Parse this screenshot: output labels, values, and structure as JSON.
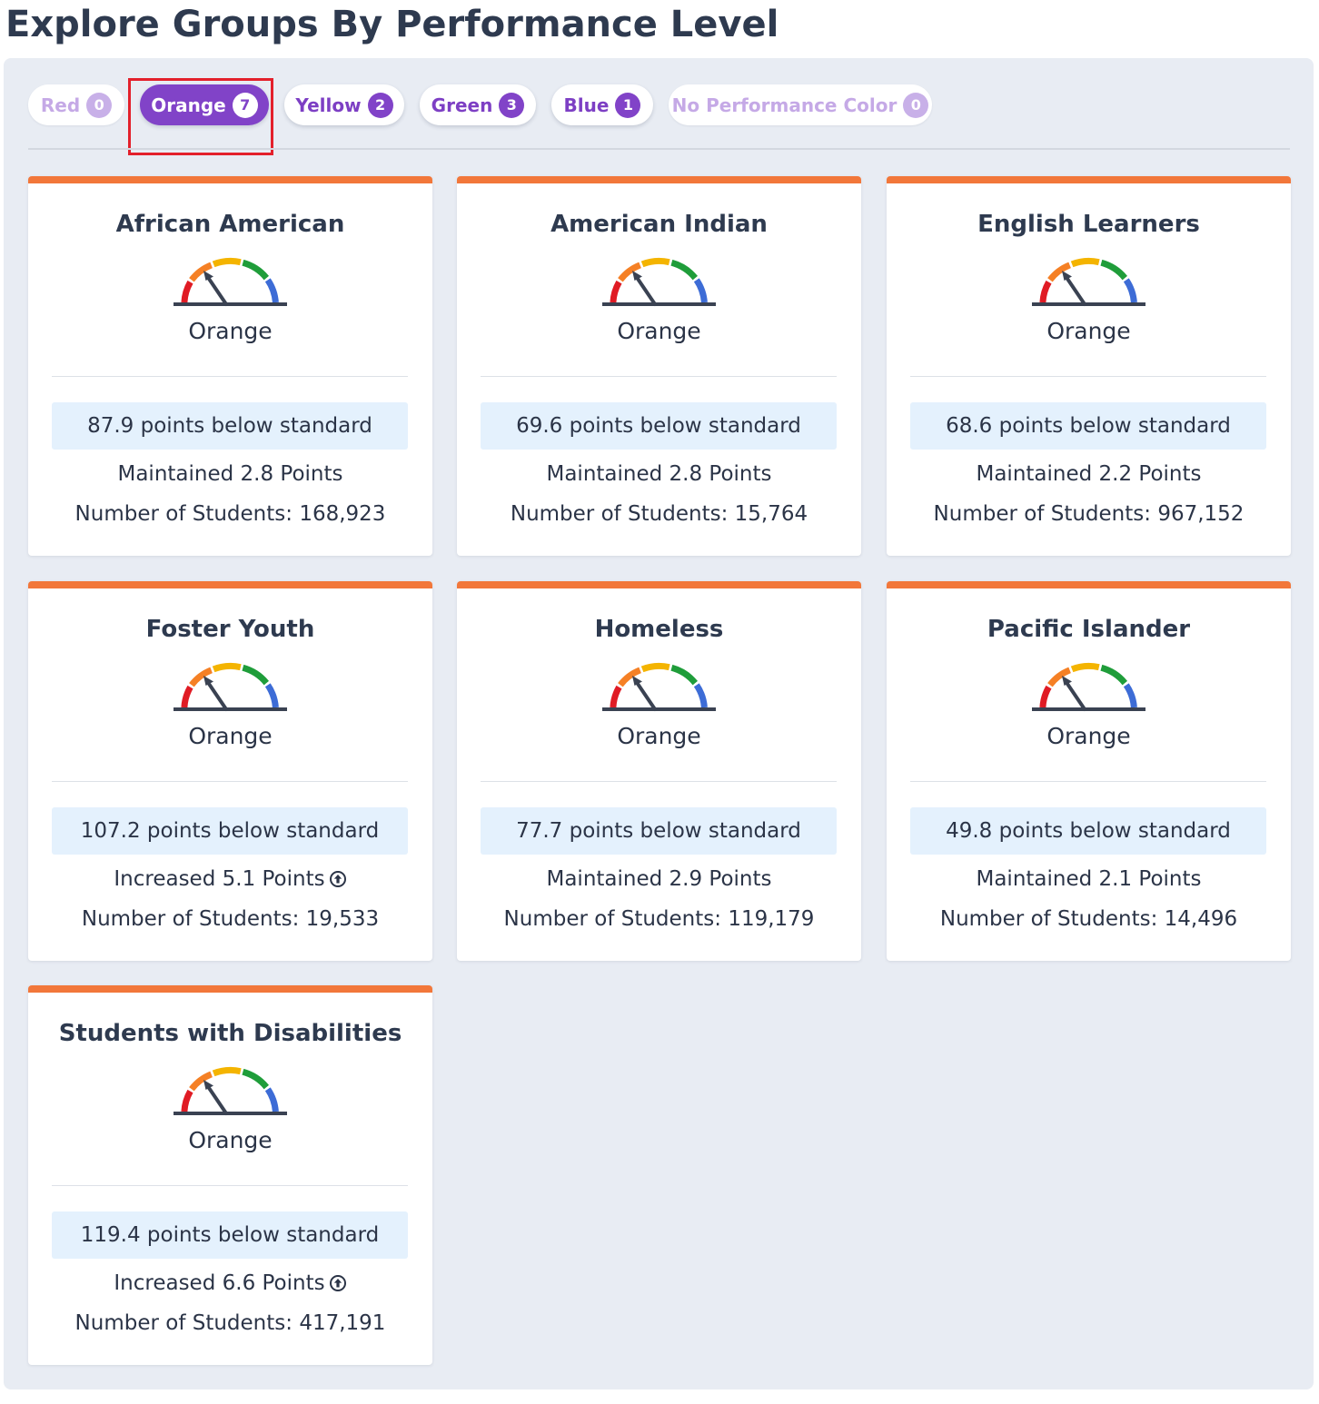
{
  "page": {
    "title": "Explore Groups By Performance Level"
  },
  "filters": [
    {
      "label": "Red",
      "count": "0",
      "state": "disabled"
    },
    {
      "label": "Orange",
      "count": "7",
      "state": "active"
    },
    {
      "label": "Yellow",
      "count": "2",
      "state": "normal"
    },
    {
      "label": "Green",
      "count": "3",
      "state": "normal"
    },
    {
      "label": "Blue",
      "count": "1",
      "state": "normal"
    },
    {
      "label": "No Performance Color",
      "count": "0",
      "state": "disabled"
    }
  ],
  "colors": {
    "accent_purple": "#8143c8",
    "card_top_orange": "#f2773a",
    "gauge_red": "#e01b24",
    "gauge_orange": "#f58025",
    "gauge_yellow": "#f4b400",
    "gauge_green": "#1f9d3a",
    "gauge_blue": "#3d6cd6",
    "highlight_red": "#e3202b"
  },
  "groups": [
    {
      "name": "African American",
      "level": "Orange",
      "status": "87.9 points below standard",
      "change": "Maintained 2.8 Points",
      "change_icon": "",
      "students": "Number of Students: 168,923"
    },
    {
      "name": "American Indian",
      "level": "Orange",
      "status": "69.6 points below standard",
      "change": "Maintained 2.8 Points",
      "change_icon": "",
      "students": "Number of Students: 15,764"
    },
    {
      "name": "English Learners",
      "level": "Orange",
      "status": "68.6 points below standard",
      "change": "Maintained 2.2 Points",
      "change_icon": "",
      "students": "Number of Students: 967,152"
    },
    {
      "name": "Foster Youth",
      "level": "Orange",
      "status": "107.2 points below standard",
      "change": "Increased 5.1 Points",
      "change_icon": "arrow-up-circle-icon",
      "students": "Number of Students: 19,533"
    },
    {
      "name": "Homeless",
      "level": "Orange",
      "status": "77.7 points below standard",
      "change": "Maintained 2.9 Points",
      "change_icon": "",
      "students": "Number of Students: 119,179"
    },
    {
      "name": "Pacific Islander",
      "level": "Orange",
      "status": "49.8 points below standard",
      "change": "Maintained 2.1 Points",
      "change_icon": "",
      "students": "Number of Students: 14,496"
    },
    {
      "name": "Students with Disabilities",
      "level": "Orange",
      "status": "119.4 points below standard",
      "change": "Increased 6.6 Points",
      "change_icon": "arrow-up-circle-icon",
      "students": "Number of Students: 417,191"
    }
  ]
}
